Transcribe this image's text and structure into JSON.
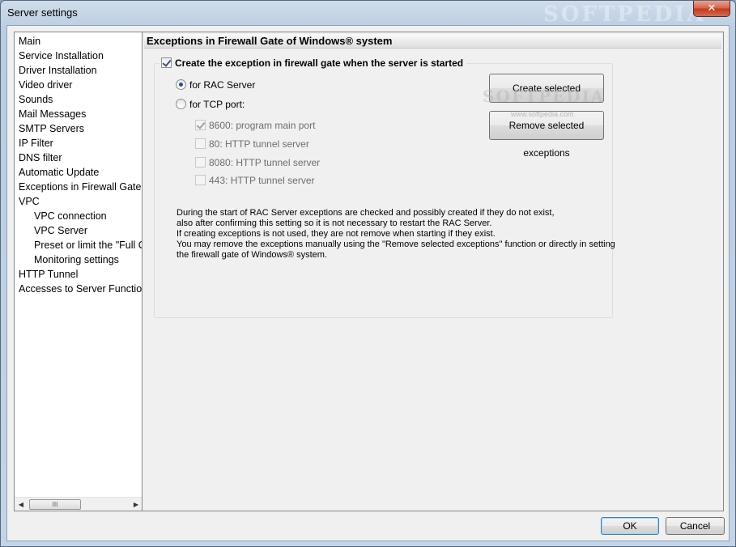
{
  "window": {
    "title": "Server settings",
    "watermark": "SOFTPEDIA",
    "close_glyph": "✕"
  },
  "sidebar": {
    "items": [
      {
        "label": "Main",
        "level": 0
      },
      {
        "label": "Service Installation",
        "level": 0
      },
      {
        "label": "Driver Installation",
        "level": 0
      },
      {
        "label": "Video driver",
        "level": 0
      },
      {
        "label": "Sounds",
        "level": 0
      },
      {
        "label": "Mail Messages",
        "level": 0
      },
      {
        "label": "SMTP Servers",
        "level": 0
      },
      {
        "label": "IP Filter",
        "level": 0
      },
      {
        "label": "DNS filter",
        "level": 0
      },
      {
        "label": "Automatic Update",
        "level": 0
      },
      {
        "label": "Exceptions in Firewall Gate of Windows® system",
        "level": 0
      },
      {
        "label": "VPC",
        "level": 0
      },
      {
        "label": "VPC connection",
        "level": 1
      },
      {
        "label": "VPC Server",
        "level": 1
      },
      {
        "label": "Preset or limit the \"Full Control\"",
        "level": 1
      },
      {
        "label": "Monitoring settings",
        "level": 1
      },
      {
        "label": "HTTP Tunnel",
        "level": 0
      },
      {
        "label": "Accesses to Server Functions",
        "level": 0
      }
    ],
    "scroll_left_glyph": "◀",
    "scroll_right_glyph": "▶",
    "scroll_thumb_glyph": "III"
  },
  "panel": {
    "header": "Exceptions in Firewall Gate of Windows® system",
    "group_label": "Create the exception in firewall gate when the server is started",
    "group_checked": true,
    "radio_rac": "for RAC Server",
    "radio_tcp": "for TCP port:",
    "selected_radio": "rac",
    "ports": [
      {
        "label": "8600: program main port",
        "checked": true
      },
      {
        "label": "80: HTTP tunnel server",
        "checked": false
      },
      {
        "label": "8080: HTTP tunnel server",
        "checked": false
      },
      {
        "label": "443: HTTP tunnel server",
        "checked": false
      }
    ],
    "create_button": "Create selected exceptions",
    "remove_button": "Remove selected exceptions",
    "watermark": "SOFTPEDIA",
    "watermark_url": "www.softpedia.com",
    "info_lines": [
      "During the start of RAC Server exceptions are checked and possibly created if they do not exist,",
      "also after confirming this setting so it is not necessary to restart the RAC Server.",
      "If creating exceptions is not used, they are not remove when starting if they exist.",
      "You may remove the exceptions manually using the \"Remove selected exceptions\" function or directly in setting",
      "the firewall gate of Windows® system."
    ]
  },
  "footer": {
    "ok": "OK",
    "cancel": "Cancel"
  }
}
